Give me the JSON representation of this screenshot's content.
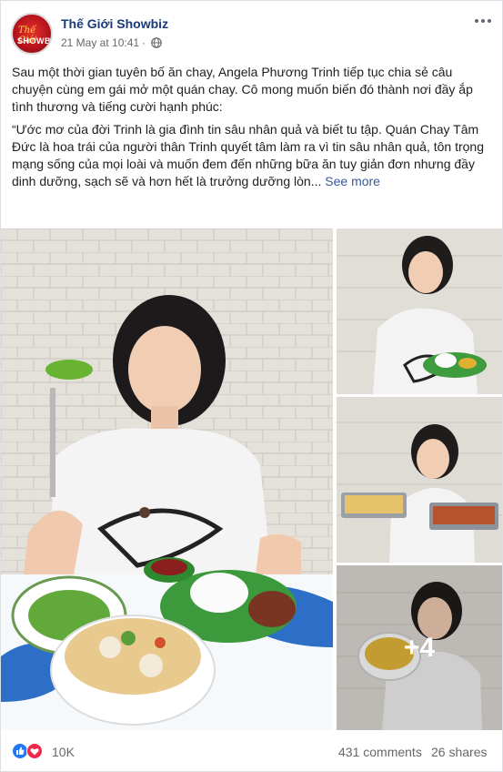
{
  "post": {
    "page_name": "Thế Giới Showbiz",
    "timestamp": "21 May at 10:41",
    "privacy_icon": "globe-icon",
    "avatar_logo": {
      "line1": "Thế Giới",
      "line2": "SHOWBIZ"
    },
    "paragraph_1": "Sau một thời gian tuyên bố ăn chay, Angela Phương Trinh tiếp tục chia sẻ câu chuyện cùng em gái mở một quán chay. Cô mong muốn biến đó thành nơi đầy ắp tình thương và tiếng cười hạnh phúc:",
    "paragraph_2": "“Ước mơ của đời Trinh là gia đình tin sâu nhân quả và biết tu tập. Quán Chay Tâm Đức là hoa trái của người thân Trinh quyết tâm làm ra vì tin sâu nhân quả, tôn trọng mạng sống của mọi loài và muốn đem đến những bữa ăn tuy giản đơn nhưng đầy dinh dưỡng, sạch sẽ và hơn hết là trưởng dưỡng lòn...",
    "see_more": "See more"
  },
  "photos": {
    "more_count": "+4"
  },
  "footer": {
    "reaction_count": "10K",
    "comments": "431 comments",
    "shares": "26 shares"
  },
  "colors": {
    "page_name": "#1a3a7a",
    "link": "#385898",
    "like": "#2078f4",
    "love": "#f0284a"
  }
}
